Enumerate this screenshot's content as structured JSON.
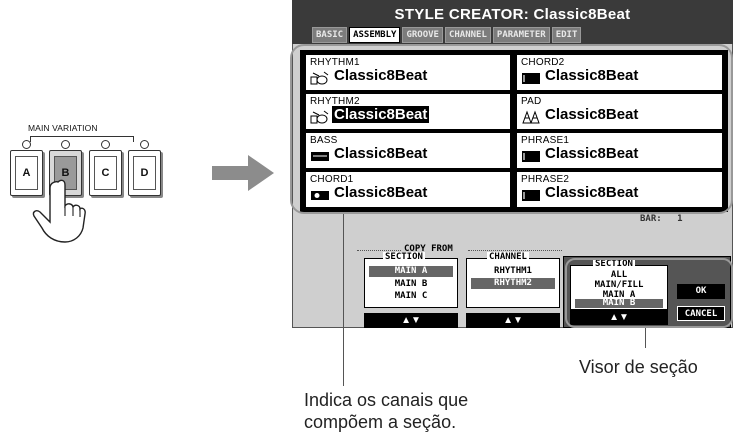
{
  "left_panel": {
    "group_label": "MAIN VARIATION",
    "buttons": [
      "A",
      "B",
      "C",
      "D"
    ],
    "pressed": "B"
  },
  "screen": {
    "title": "STYLE CREATOR: Classic8Beat",
    "tabs": [
      "BASIC",
      "ASSEMBLY",
      "GROOVE",
      "CHANNEL",
      "PARAMETER",
      "EDIT"
    ],
    "active_tab": "ASSEMBLY",
    "channels": [
      {
        "channel": "RHYTHM1",
        "style": "Classic8Beat",
        "icon": "drum-kit-icon",
        "selected": false
      },
      {
        "channel": "CHORD2",
        "style": "Classic8Beat",
        "icon": "keyboard-icon",
        "selected": false
      },
      {
        "channel": "RHYTHM2",
        "style": "Classic8Beat",
        "icon": "drum-kit-icon",
        "selected": true
      },
      {
        "channel": "PAD",
        "style": "Classic8Beat",
        "icon": "strings-icon",
        "selected": false
      },
      {
        "channel": "BASS",
        "style": "Classic8Beat",
        "icon": "bass-guitar-icon",
        "selected": false
      },
      {
        "channel": "PHRASE1",
        "style": "Classic8Beat",
        "icon": "keyboard-icon",
        "selected": false
      },
      {
        "channel": "CHORD1",
        "style": "Classic8Beat",
        "icon": "guitar-icon",
        "selected": false
      },
      {
        "channel": "PHRASE2",
        "style": "Classic8Beat",
        "icon": "keyboard-icon",
        "selected": false
      }
    ],
    "bar_label": "BAR:",
    "bar_value": "1",
    "copy_from": {
      "label": "COPY FROM",
      "section_title": "SECTION",
      "sections": [
        "MAIN A",
        "MAIN B",
        "MAIN C"
      ],
      "selected_section": "MAIN A",
      "channel_title": "CHANNEL",
      "channels": [
        "RHYTHM1",
        "RHYTHM2"
      ],
      "selected_channel": "RHYTHM2"
    },
    "section_popup": {
      "title": "SECTION",
      "items": [
        "ALL",
        "MAIN/FILL",
        "MAIN A",
        "MAIN B"
      ],
      "selected": "MAIN B",
      "ok_label": "OK",
      "cancel_label": "CANCEL"
    },
    "arrow_label": "▲▼"
  },
  "captions": {
    "section_display": "Visor de seção",
    "channels_note_line1": "Indica os canais que",
    "channels_note_line2": "compõem a seção."
  }
}
